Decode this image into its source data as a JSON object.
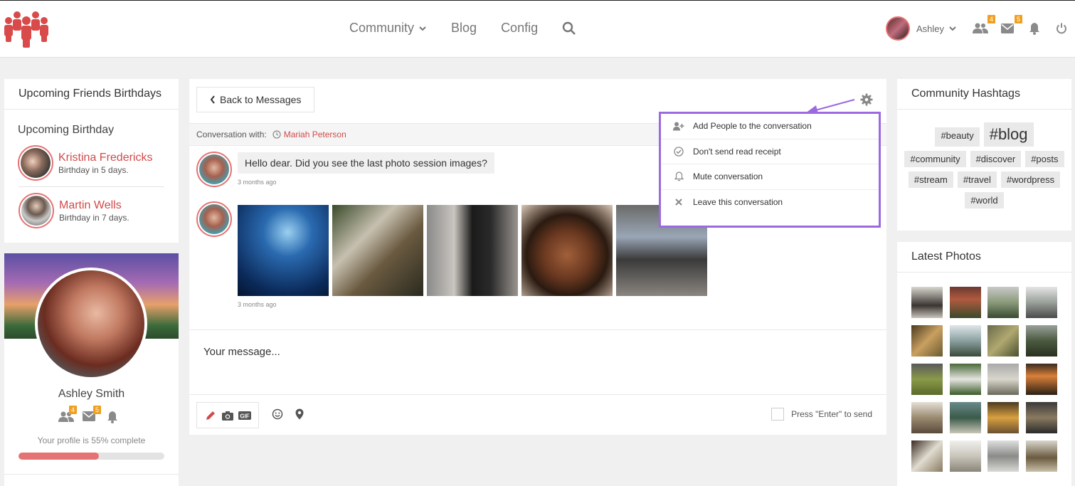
{
  "header": {
    "nav": [
      {
        "label": "Community",
        "has_dropdown": true
      },
      {
        "label": "Blog"
      },
      {
        "label": "Config"
      }
    ],
    "user": {
      "name": "Ashley"
    },
    "badges": {
      "friends": "4",
      "messages": "5"
    }
  },
  "birthdays": {
    "title": "Upcoming Friends Birthdays",
    "subtitle": "Upcoming Birthday",
    "items": [
      {
        "name": "Kristina Fredericks",
        "when": "Birthday in 5 days."
      },
      {
        "name": "Martin Wells",
        "when": "Birthday in 7 days."
      }
    ]
  },
  "profile": {
    "name": "Ashley Smith",
    "badges": {
      "friends": "4",
      "messages": "5"
    },
    "complete_text": "Your profile is 55% complete",
    "complete_percent": 55
  },
  "conversation": {
    "back_label": "Back to Messages",
    "with_label": "Conversation with:",
    "partner": "Mariah Peterson",
    "messages": [
      {
        "text": "Hello dear. Did you see the last photo session images?",
        "time": "3 months ago"
      },
      {
        "photos": 5,
        "time": "3 months ago"
      }
    ],
    "compose_placeholder": "Your message...",
    "enter_to_send": "Press \"Enter\" to send"
  },
  "settings_menu": {
    "items": [
      {
        "label": "Add People to the conversation",
        "icon": "add-user-icon"
      },
      {
        "label": "Don't send read receipt",
        "icon": "check-circle-icon"
      },
      {
        "label": "Mute conversation",
        "icon": "bell-icon"
      },
      {
        "label": "Leave this conversation",
        "icon": "close-icon"
      }
    ]
  },
  "hashtags": {
    "title": "Community Hashtags",
    "tags": [
      "#beauty",
      "#blog",
      "#community",
      "#discover",
      "#posts",
      "#stream",
      "#travel",
      "#wordpress",
      "#world"
    ]
  },
  "latest_photos": {
    "title": "Latest Photos"
  },
  "colors": {
    "accent": "#d14a4a",
    "highlight": "#9b6ae0",
    "badge": "#f0a020"
  }
}
